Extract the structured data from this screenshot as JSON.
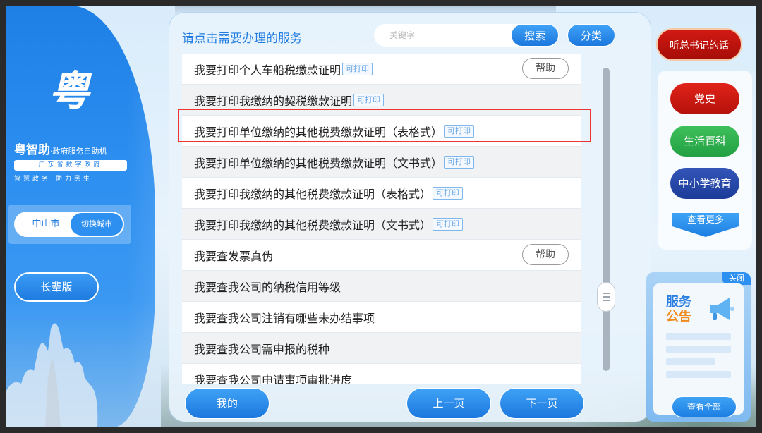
{
  "left": {
    "logo_glyph": "粤",
    "brand_title": "粤智助",
    "brand_subtitle": "·政府服务自助机",
    "brand_strip": "广东省数字政府",
    "brand_slogan": "智慧政务  助力民生",
    "city_current": "中山市",
    "city_switch": "切换城市",
    "senior_mode": "长辈版"
  },
  "main": {
    "title": "请点击需要办理的服务",
    "search_placeholder": "关键字",
    "search_btn": "搜索",
    "category_btn": "分类",
    "printable_tag": "可打印",
    "help_label": "帮助",
    "rows": [
      {
        "label": "我要打印个人车船税缴款证明",
        "printable": true,
        "help": true
      },
      {
        "label": "我要打印我缴纳的契税缴款证明",
        "printable": true,
        "help": false
      },
      {
        "label": "我要打印单位缴纳的其他税费缴款证明（表格式）",
        "printable": true,
        "help": false
      },
      {
        "label": "我要打印单位缴纳的其他税费缴款证明（文书式）",
        "printable": true,
        "help": false
      },
      {
        "label": "我要打印我缴纳的其他税费缴款证明（表格式）",
        "printable": true,
        "help": false
      },
      {
        "label": "我要打印我缴纳的其他税费缴款证明（文书式）",
        "printable": true,
        "help": false
      },
      {
        "label": "我要查发票真伪",
        "printable": false,
        "help": true
      },
      {
        "label": "我要查我公司的纳税信用等级",
        "printable": false,
        "help": false
      },
      {
        "label": "我要查我公司注销有哪些未办结事项",
        "printable": false,
        "help": false
      },
      {
        "label": "我要查我公司需申报的税种",
        "printable": false,
        "help": false
      },
      {
        "label": "我要查我公司申请事项审批进度",
        "printable": false,
        "help": false
      }
    ],
    "mine_btn": "我的",
    "prev_btn": "上一页",
    "next_btn": "下一页"
  },
  "right": {
    "listen_btn": "听总书记的话",
    "nav": {
      "history": "党史",
      "life": "生活百科",
      "education": "中小学教育",
      "more": "查看更多"
    },
    "notice": {
      "close": "关闭",
      "title_line1": "服务",
      "title_line2": "公告",
      "view_all": "查看全部"
    }
  },
  "colors": {
    "primary": "#1f7be0",
    "highlight": "#e33333",
    "history": "#d21a12",
    "life": "#3ec05a",
    "education": "#2545a8"
  }
}
